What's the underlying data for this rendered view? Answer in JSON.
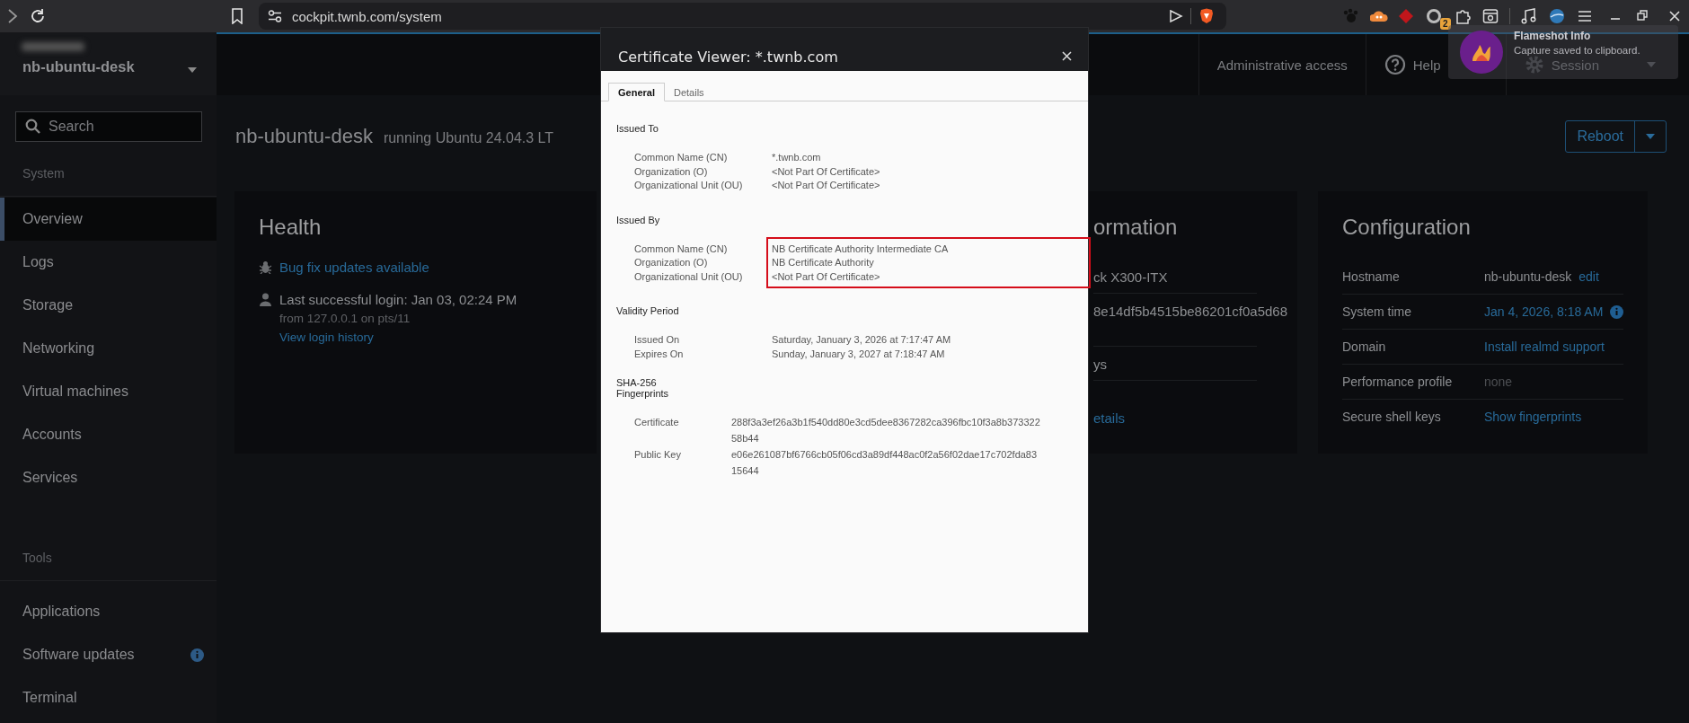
{
  "browser": {
    "url": "cockpit.twnb.com/system",
    "extension_badge": "2"
  },
  "topbar": {
    "host": "nb-ubuntu-desk",
    "admin": "Administrative access",
    "help": "Help",
    "session": "Session"
  },
  "sidebar": {
    "search": {
      "placeholder": "Search"
    },
    "sections": [
      {
        "title": "System",
        "items": [
          {
            "label": "Overview",
            "selected": true,
            "badge": false
          },
          {
            "label": "Logs",
            "selected": false,
            "badge": false
          },
          {
            "label": "Storage",
            "selected": false,
            "badge": false
          },
          {
            "label": "Networking",
            "selected": false,
            "badge": false
          },
          {
            "label": "Virtual machines",
            "selected": false,
            "badge": false
          },
          {
            "label": "Accounts",
            "selected": false,
            "badge": false
          },
          {
            "label": "Services",
            "selected": false,
            "badge": false
          }
        ]
      },
      {
        "title": "Tools",
        "items": [
          {
            "label": "Applications",
            "selected": false,
            "badge": false
          },
          {
            "label": "Software updates",
            "selected": false,
            "badge": true
          },
          {
            "label": "Terminal",
            "selected": false,
            "badge": false
          }
        ]
      }
    ]
  },
  "header": {
    "hostname": "nb-ubuntu-desk",
    "subtitle": "running Ubuntu 24.04.3 LT",
    "reboot": "Reboot"
  },
  "health": {
    "title": "Health",
    "updates_link": "Bug fix updates available",
    "login": "Last successful login: Jan 03, 02:24 PM",
    "login_from": "from 127.0.0.1 on pts/11",
    "history_link": "View login history"
  },
  "system_info": {
    "title": "ormation",
    "rows": [
      "ck X300-ITX",
      "8e14df5b4515be86201cf0a5d68",
      "ys"
    ],
    "link": "etails"
  },
  "configuration": {
    "title": "Configuration",
    "rows": [
      {
        "label": "Hostname",
        "value": "nb-ubuntu-desk",
        "kind": "text",
        "action": "edit",
        "info_icon": false
      },
      {
        "label": "System time",
        "value": "Jan 4, 2026, 8:18 AM",
        "kind": "link",
        "info_icon": true
      },
      {
        "label": "Domain",
        "value": "Install realmd support",
        "kind": "link",
        "info_icon": false
      },
      {
        "label": "Performance profile",
        "value": "none",
        "kind": "muted",
        "info_icon": false
      },
      {
        "label": "Secure shell keys",
        "value": "Show fingerprints",
        "kind": "link",
        "info_icon": false
      }
    ]
  },
  "dialog": {
    "title": "Certificate Viewer: *.twnb.com",
    "tabs": [
      {
        "label": "General",
        "selected": true
      },
      {
        "label": "Details",
        "selected": false
      }
    ],
    "sections": [
      {
        "title": "Issued To",
        "kind": "fields",
        "highlighted": false,
        "rows": [
          {
            "label": "Common Name (CN)",
            "value": "*.twnb.com"
          },
          {
            "label": "Organization (O)",
            "value": "<Not Part Of Certificate>"
          },
          {
            "label": "Organizational Unit (OU)",
            "value": "<Not Part Of Certificate>"
          }
        ]
      },
      {
        "title": "Issued By",
        "kind": "fields",
        "highlighted": true,
        "rows": [
          {
            "label": "Common Name (CN)",
            "value": "NB Certificate Authority Intermediate CA"
          },
          {
            "label": "Organization (O)",
            "value": "NB Certificate Authority"
          },
          {
            "label": "Organizational Unit (OU)",
            "value": "<Not Part Of Certificate>"
          }
        ]
      },
      {
        "title": "Validity Period",
        "kind": "fields",
        "highlighted": false,
        "rows": [
          {
            "label": "Issued On",
            "value": "Saturday, January 3, 2026 at 7:17:47 AM"
          },
          {
            "label": "Expires On",
            "value": "Sunday, January 3, 2027 at 7:18:47 AM"
          }
        ]
      },
      {
        "title": "SHA-256 Fingerprints",
        "kind": "fingerprints",
        "highlighted": false,
        "rows": [
          {
            "label": "Certificate",
            "value": "288f3a3ef26a3b1f540dd80e3cd5dee8367282ca396fbc10f3a8b37332258b44"
          },
          {
            "label": "Public Key",
            "value": "e06e261087bf6766cb05f06cd3a89df448ac0f2a56f02dae17c702fda8315644"
          }
        ]
      }
    ]
  },
  "notification": {
    "title": "Flameshot Info",
    "message": "Capture saved to clipboard."
  }
}
